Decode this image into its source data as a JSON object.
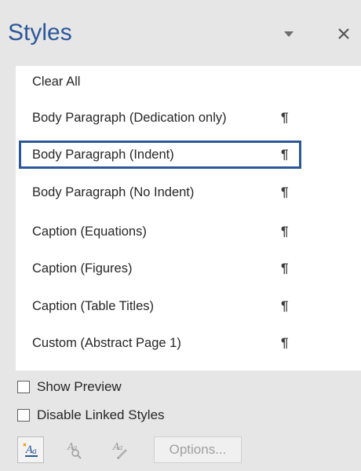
{
  "pane": {
    "title": "Styles",
    "dropdown_icon": "chevron-down-icon",
    "close_icon": "close-icon"
  },
  "styles": [
    {
      "label": "Clear All",
      "mark": ""
    },
    {
      "label": "Body Paragraph (Dedication only)",
      "mark": "¶"
    },
    {
      "label": "Body Paragraph (Indent)",
      "mark": "¶",
      "selected": true
    },
    {
      "label": "Body Paragraph (No Indent)",
      "mark": "¶"
    },
    {
      "label": "Caption (Equations)",
      "mark": "¶"
    },
    {
      "label": "Caption (Figures)",
      "mark": "¶"
    },
    {
      "label": "Caption (Table Titles)",
      "mark": "¶"
    },
    {
      "label": "Custom (Abstract Page 1)",
      "mark": "¶"
    }
  ],
  "options": {
    "show_preview": {
      "label": "Show Preview",
      "checked": false
    },
    "disable_linked": {
      "label": "Disable Linked Styles",
      "checked": false
    }
  },
  "toolbar": {
    "new_style_icon": "new-style-icon",
    "style_inspector_icon": "style-inspector-icon",
    "manage_styles_icon": "manage-styles-icon",
    "options_label": "Options...",
    "accent_color": "#2b579a"
  }
}
